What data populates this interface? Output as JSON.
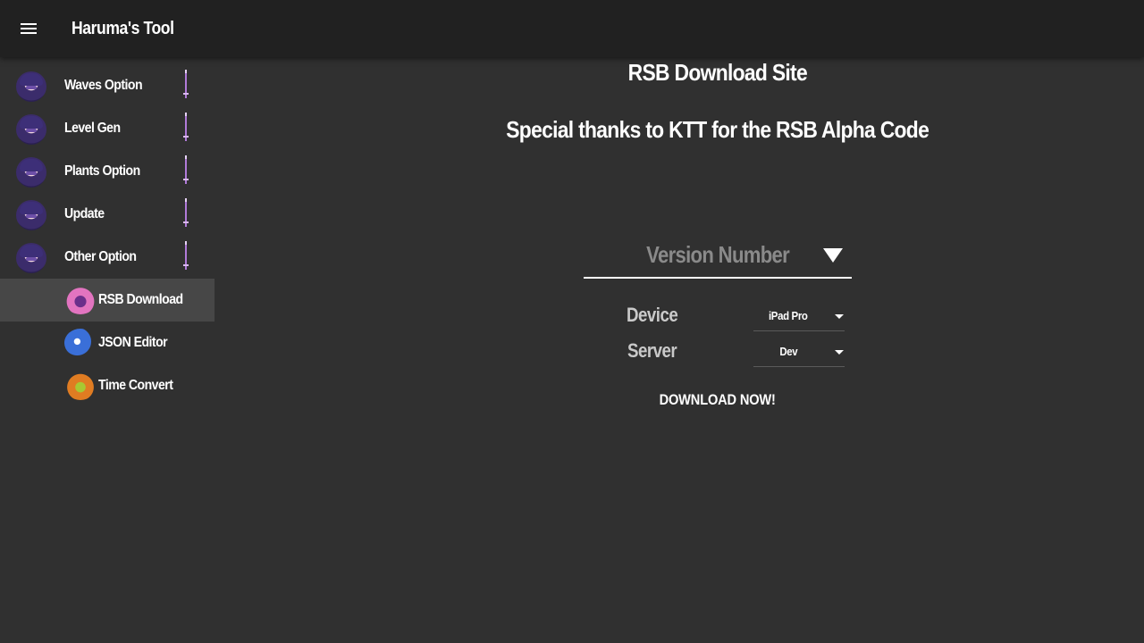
{
  "app": {
    "title": "Haruma's Tool"
  },
  "sidebar": {
    "items": [
      {
        "label": "Waves Option",
        "icon": "character-avatar-icon"
      },
      {
        "label": "Level Gen",
        "icon": "character-avatar-icon"
      },
      {
        "label": "Plants Option",
        "icon": "character-avatar-icon"
      },
      {
        "label": "Update",
        "icon": "character-avatar-icon"
      },
      {
        "label": "Other Option",
        "icon": "character-avatar-icon"
      }
    ],
    "sub_items": [
      {
        "label": "RSB Download",
        "icon": "pink-plant-icon",
        "active": true
      },
      {
        "label": "JSON Editor",
        "icon": "wizard-zombie-icon",
        "active": false
      },
      {
        "label": "Time Convert",
        "icon": "green-plant-icon",
        "active": false
      }
    ]
  },
  "main": {
    "site_title": "RSB Download Site",
    "thanks_text": "Special thanks to KTT for the RSB Alpha Code",
    "version_select": {
      "placeholder": "Version Number"
    },
    "device": {
      "label": "Device",
      "value": "iPad Pro"
    },
    "server": {
      "label": "Server",
      "value": "Dev"
    },
    "download_button": "DOWNLOAD NOW!"
  },
  "colors": {
    "background": "#303030",
    "topbar": "#212121",
    "active_item": "#474747",
    "placeholder_text": "#8a8a8a",
    "sword_accent": "#9b59c9"
  }
}
